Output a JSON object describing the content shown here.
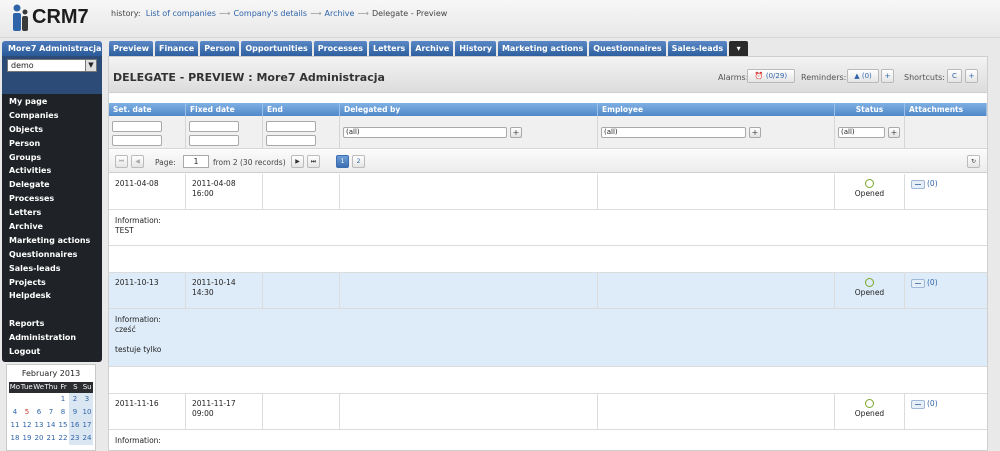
{
  "app": {
    "brand": "CRM7"
  },
  "breadcrumb": {
    "prefix": "history:",
    "items": [
      "List of companies",
      "Company's details",
      "Archive"
    ],
    "current": "Delegate - Preview"
  },
  "sidebar": {
    "user": "More7 Administracja",
    "company_select": "demo",
    "menu": [
      "My page",
      "Companies",
      "Objects",
      "Person",
      "Groups",
      "Activities",
      "Delegate",
      "Processes",
      "Letters",
      "Archive",
      "Marketing actions",
      "Questionnaires",
      "Sales-leads",
      "Projects",
      "Helpdesk"
    ],
    "menu_bottom": [
      "Reports",
      "Administration",
      "Logout"
    ]
  },
  "calendar": {
    "title": "February 2013",
    "days": [
      "Mo",
      "Tue",
      "We",
      "Thu",
      "Fr",
      "S",
      "Su"
    ],
    "weeks": [
      [
        "",
        "",
        "",
        "",
        "1",
        "2",
        "3"
      ],
      [
        "4",
        "5",
        "6",
        "7",
        "8",
        "9",
        "10"
      ],
      [
        "11",
        "12",
        "13",
        "14",
        "15",
        "16",
        "17"
      ],
      [
        "18",
        "19",
        "20",
        "21",
        "22",
        "23",
        "24"
      ]
    ]
  },
  "tabs": [
    "Preview",
    "Finance",
    "Person",
    "Opportunities",
    "Processes",
    "Letters",
    "Archive",
    "History",
    "Marketing actions",
    "Questionnaires",
    "Sales-leads"
  ],
  "header": {
    "title": "DELEGATE - PREVIEW : More7 Administracja",
    "alarms_label": "Alarms:",
    "alarms_value": "(0/29)",
    "reminders_label": "Reminders:",
    "reminders_value": "(0)",
    "shortcuts_label": "Shortcuts:"
  },
  "grid": {
    "columns": [
      "Set. date",
      "Fixed date",
      "End",
      "Delegated by",
      "Employee",
      "Status",
      "Attachments"
    ],
    "filter_all": "(all)",
    "pager": {
      "page_label": "Page:",
      "page_value": "1",
      "of_text": "from 2 (30 records)",
      "pages": [
        "1",
        "2"
      ]
    },
    "info_label": "Information:",
    "records": [
      {
        "set_date": "2011-04-08",
        "fixed_date": "2011-04-08",
        "fixed_time": "16:00",
        "status": "Opened",
        "attachments": "(0)",
        "info_lines": [
          "TEST"
        ]
      },
      {
        "set_date": "2011-10-13",
        "fixed_date": "2011-10-14",
        "fixed_time": "14:30",
        "status": "Opened",
        "attachments": "(0)",
        "info_lines": [
          "cześć",
          "testuje tylko"
        ]
      },
      {
        "set_date": "2011-11-16",
        "fixed_date": "2011-11-17",
        "fixed_time": "09:00",
        "status": "Opened",
        "attachments": "(0)",
        "info_lines": []
      }
    ]
  }
}
